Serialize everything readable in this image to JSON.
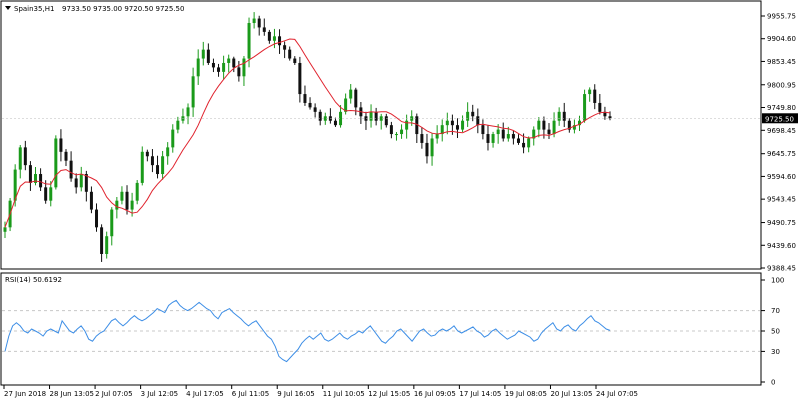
{
  "header": {
    "symbol_label": "Spain35,H1",
    "ohlc": "9733.50 9735.00 9720.50 9725.50"
  },
  "rsi_header": {
    "label": "RSI(14) 50.6192"
  },
  "colors": {
    "bull": "#1a9a1a",
    "bear": "#111111",
    "ma": "#e0232e",
    "rsi": "#3d8ee6",
    "price_tag_bg": "#000000",
    "price_tag_fg": "#ffffff",
    "grid": "#c8c8c8"
  },
  "chart_data": [
    {
      "type": "candlestick",
      "title": "Spain35,H1",
      "ylim": [
        9388.45,
        9955.75
      ],
      "y_ticks": [
        "9955.75",
        "9904.60",
        "9853.45",
        "9800.95",
        "9749.80",
        "9698.45",
        "9645.75",
        "9594.60",
        "9543.45",
        "9490.75",
        "9439.60",
        "9388.45"
      ],
      "x_ticks": [
        "27 Jun 2018",
        "28 Jun 13:05",
        "2 Jul 07:05",
        "3 Jul 12:05",
        "4 Jul 17:05",
        "6 Jul 11:05",
        "9 Jul 16:05",
        "11 Jul 10:05",
        "12 Jul 15:05",
        "16 Jul 09:05",
        "17 Jul 14:05",
        "19 Jul 08:05",
        "20 Jul 13:05",
        "24 Jul 07:05"
      ],
      "last_price": "9725.50",
      "moving_average": true,
      "close_path": [
        9480,
        9540,
        9610,
        9660,
        9620,
        9580,
        9600,
        9570,
        9540,
        9570,
        9680,
        9650,
        9630,
        9590,
        9570,
        9600,
        9560,
        9520,
        9480,
        9420,
        9460,
        9520,
        9540,
        9560,
        9520,
        9540,
        9580,
        9650,
        9640,
        9620,
        9600,
        9640,
        9660,
        9700,
        9720,
        9730,
        9750,
        9820,
        9860,
        9880,
        9850,
        9840,
        9830,
        9850,
        9860,
        9840,
        9820,
        9860,
        9940,
        9950,
        9930,
        9920,
        9900,
        9910,
        9890,
        9880,
        9860,
        9850,
        9780,
        9760,
        9750,
        9740,
        9720,
        9730,
        9720,
        9710,
        9740,
        9770,
        9790,
        9750,
        9730,
        9720,
        9740,
        9720,
        9730,
        9710,
        9690,
        9690,
        9700,
        9720,
        9730,
        9690,
        9670,
        9640,
        9680,
        9690,
        9710,
        9720,
        9710,
        9700,
        9720,
        9740,
        9730,
        9710,
        9690,
        9670,
        9690,
        9700,
        9680,
        9690,
        9680,
        9670,
        9660,
        9680,
        9700,
        9720,
        9700,
        9690,
        9720,
        9740,
        9720,
        9700,
        9710,
        9720,
        9780,
        9790,
        9760,
        9740,
        9730,
        9725.5
      ]
    },
    {
      "type": "line",
      "title": "RSI(14) 50.6192",
      "ylim": [
        0,
        100
      ],
      "y_ticks": [
        "100",
        "70",
        "50",
        "30",
        "0"
      ],
      "levels": [
        70,
        50,
        30
      ],
      "values": [
        30,
        45,
        55,
        58,
        55,
        50,
        48,
        52,
        50,
        48,
        45,
        50,
        52,
        50,
        48,
        60,
        55,
        50,
        48,
        52,
        55,
        50,
        42,
        40,
        45,
        48,
        50,
        55,
        60,
        62,
        58,
        55,
        58,
        62,
        65,
        62,
        60,
        62,
        65,
        68,
        72,
        70,
        68,
        75,
        78,
        80,
        75,
        72,
        70,
        72,
        75,
        78,
        75,
        72,
        70,
        65,
        62,
        68,
        70,
        72,
        68,
        65,
        62,
        58,
        55,
        58,
        60,
        55,
        50,
        45,
        42,
        35,
        25,
        22,
        20,
        24,
        28,
        32,
        38,
        42,
        45,
        42,
        45,
        48,
        42,
        40,
        42,
        45,
        48,
        44,
        42,
        45,
        47,
        50,
        48,
        52,
        55,
        50,
        45,
        40,
        38,
        42,
        45,
        50,
        52,
        48,
        44,
        40,
        45,
        50,
        52,
        48,
        45,
        46,
        50,
        52,
        50,
        52,
        55,
        50,
        48,
        50,
        52,
        54,
        50,
        48,
        44,
        46,
        50,
        52,
        48,
        45,
        42,
        44,
        46,
        50,
        48,
        46,
        44,
        40,
        42,
        48,
        52,
        55,
        58,
        52,
        50,
        54,
        56,
        52,
        50,
        55,
        58,
        62,
        65,
        60,
        58,
        55,
        52,
        50.6
      ]
    }
  ]
}
